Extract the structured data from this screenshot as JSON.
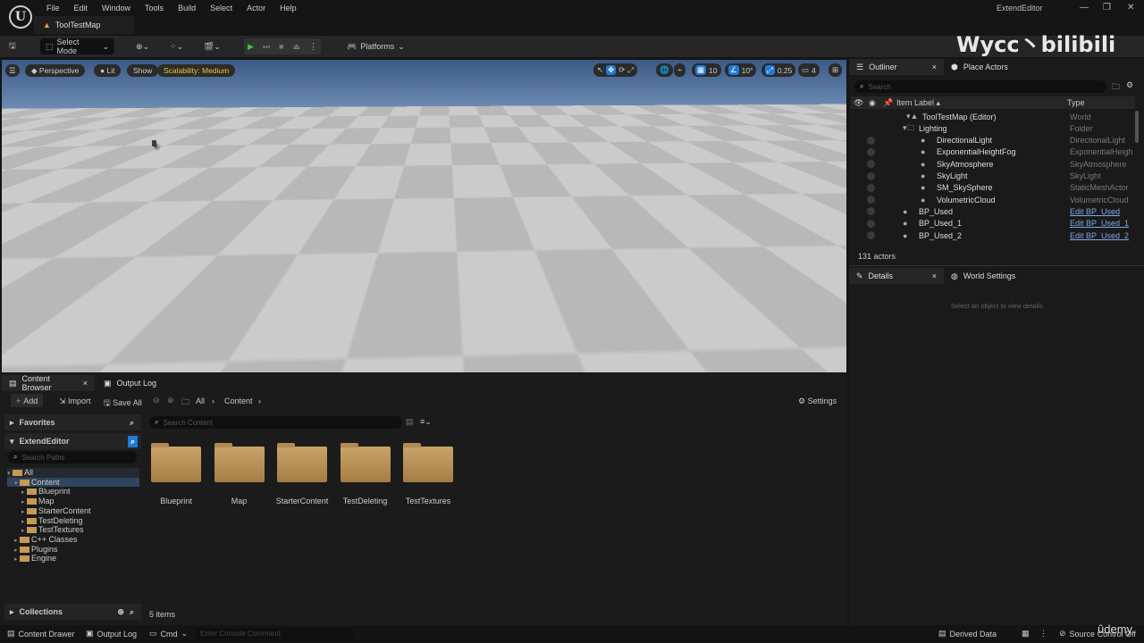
{
  "app": {
    "title": "ExtendEditor",
    "doc_tab": "ToolTestMap",
    "menu": [
      "File",
      "Edit",
      "Window",
      "Tools",
      "Build",
      "Select",
      "Actor",
      "Help"
    ],
    "window_controls": [
      "minimize-icon",
      "restore-icon",
      "close-icon"
    ]
  },
  "toolbar": {
    "mode": "Select Mode",
    "platforms": "Platforms"
  },
  "watermark": {
    "text": "Wycc丶bilibili",
    "udemy": "ûdemy"
  },
  "viewport": {
    "perspective": "Perspective",
    "lit": "Lit",
    "show": "Show",
    "scalability": "Scalability: Medium",
    "grid": "10",
    "angle": "10°",
    "scale": "0.25",
    "camera_speed": "4"
  },
  "outliner": {
    "tab": "Outliner",
    "tab2": "Place Actors",
    "search_placeholder": "Search",
    "col_label": "Item Label ▴",
    "col_type": "Type",
    "count": "131 actors",
    "rows": [
      {
        "label": "ToolTestMap (Editor)",
        "type": "World",
        "depth": 0,
        "link": false
      },
      {
        "label": "Lighting",
        "type": "Folder",
        "depth": 1,
        "link": false
      },
      {
        "label": "DirectionalLight",
        "type": "DirectionalLight",
        "depth": 2,
        "link": false
      },
      {
        "label": "ExponentialHeightFog",
        "type": "ExponentialHeightF",
        "depth": 2,
        "link": false
      },
      {
        "label": "SkyAtmosphere",
        "type": "SkyAtmosphere",
        "depth": 2,
        "link": false
      },
      {
        "label": "SkyLight",
        "type": "SkyLight",
        "depth": 2,
        "link": false
      },
      {
        "label": "SM_SkySphere",
        "type": "StaticMeshActor",
        "depth": 2,
        "link": false
      },
      {
        "label": "VolumetricCloud",
        "type": "VolumetricCloud",
        "depth": 2,
        "link": false
      },
      {
        "label": "BP_Used",
        "type": "Edit BP_Used",
        "depth": 1,
        "link": true
      },
      {
        "label": "BP_Used_1",
        "type": "Edit BP_Used_1",
        "depth": 1,
        "link": true
      },
      {
        "label": "BP_Used_2",
        "type": "Edit BP_Used_2",
        "depth": 1,
        "link": true
      }
    ]
  },
  "details": {
    "tab": "Details",
    "tab2": "World Settings",
    "empty": "Select an object to view details."
  },
  "content_browser": {
    "tab": "Content Browser",
    "tab2": "Output Log",
    "add": "Add",
    "import": "Import",
    "save_all": "Save All",
    "breadcrumb": [
      "All",
      "Content"
    ],
    "settings": "Settings",
    "favorites": "Favorites",
    "project": "ExtendEditor",
    "search_paths": "Search Paths",
    "search_content": "Search Content",
    "collections": "Collections",
    "tree": [
      {
        "label": "All",
        "depth": 0
      },
      {
        "label": "Content",
        "depth": 1
      },
      {
        "label": "Blueprint",
        "depth": 2
      },
      {
        "label": "Map",
        "depth": 2
      },
      {
        "label": "StarterContent",
        "depth": 2
      },
      {
        "label": "TestDeleting",
        "depth": 2
      },
      {
        "label": "TestTextures",
        "depth": 2
      },
      {
        "label": "C++ Classes",
        "depth": 1
      },
      {
        "label": "Plugins",
        "depth": 1
      },
      {
        "label": "Engine",
        "depth": 1
      }
    ],
    "folders": [
      "Blueprint",
      "Map",
      "StarterContent",
      "TestDeleting",
      "TestTextures"
    ],
    "item_count": "5 items"
  },
  "statusbar": {
    "content_drawer": "Content Drawer",
    "output_log": "Output Log",
    "cmd": "Cmd",
    "console_placeholder": "Enter Console Command",
    "derived_data": "Derived Data",
    "source_control": "Source Control Off"
  }
}
